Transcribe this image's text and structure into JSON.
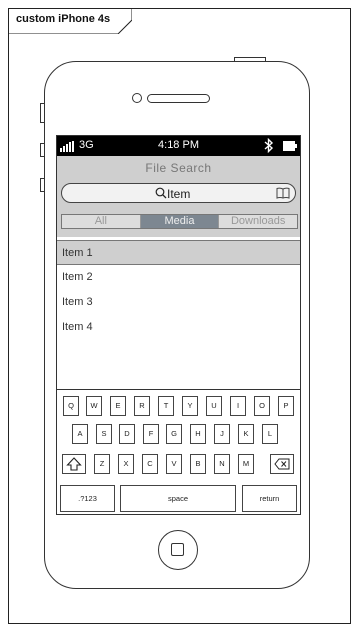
{
  "frame": {
    "label": "custom iPhone 4s"
  },
  "status_bar": {
    "carrier": "3G",
    "time": "4:18 PM"
  },
  "header": {
    "title": "File Search"
  },
  "search": {
    "text": "Item"
  },
  "segments": [
    {
      "label": "All",
      "active": false
    },
    {
      "label": "Media",
      "active": true
    },
    {
      "label": "Downloads",
      "active": false
    }
  ],
  "list": {
    "items": [
      {
        "label": "Item 1",
        "selected": true
      },
      {
        "label": "Item 2",
        "selected": false
      },
      {
        "label": "Item 3",
        "selected": false
      },
      {
        "label": "Item 4",
        "selected": false
      }
    ]
  },
  "keyboard": {
    "row1": [
      "Q",
      "W",
      "E",
      "R",
      "T",
      "Y",
      "U",
      "I",
      "O",
      "P"
    ],
    "row2": [
      "A",
      "S",
      "D",
      "F",
      "G",
      "H",
      "J",
      "K",
      "L"
    ],
    "row3": [
      "Z",
      "X",
      "C",
      "V",
      "B",
      "N",
      "M"
    ],
    "numbers_label": ".?123",
    "space_label": "space",
    "return_label": "return",
    "shift_icon": "shift-icon",
    "backspace_icon": "backspace-icon"
  }
}
